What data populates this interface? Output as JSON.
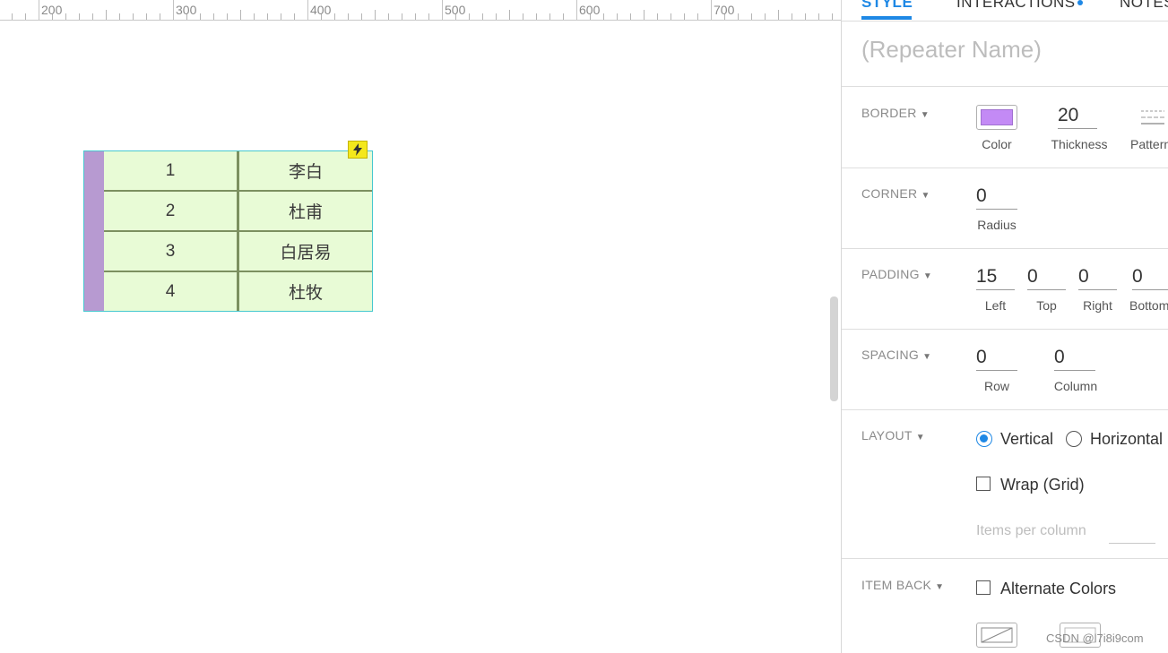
{
  "ruler": {
    "labels": [
      "200",
      "300",
      "400",
      "500",
      "600",
      "700"
    ]
  },
  "repeater": {
    "rows": [
      {
        "num": "1",
        "name": "李白"
      },
      {
        "num": "2",
        "name": "杜甫"
      },
      {
        "num": "3",
        "name": "白居易"
      },
      {
        "num": "4",
        "name": "杜牧"
      }
    ],
    "cell_color": "#e8fbd6",
    "border_color": "#b79ad1"
  },
  "panel": {
    "tabs": {
      "style": "STYLE",
      "interactions": "INTERACTIONS",
      "notes": "NOTES"
    },
    "repeater_name_placeholder": "(Repeater Name)",
    "border": {
      "label": "BORDER",
      "color_label": "Color",
      "color": "#c38af5",
      "thickness": "20",
      "thickness_label": "Thickness",
      "pattern_label": "Pattern"
    },
    "corner": {
      "label": "CORNER",
      "radius": "0",
      "radius_label": "Radius"
    },
    "padding": {
      "label": "PADDING",
      "left": "15",
      "left_label": "Left",
      "top": "0",
      "top_label": "Top",
      "right": "0",
      "right_label": "Right",
      "bottom": "0",
      "bottom_label": "Bottom"
    },
    "spacing": {
      "label": "SPACING",
      "row": "0",
      "row_label": "Row",
      "column": "0",
      "column_label": "Column"
    },
    "layout": {
      "label": "LAYOUT",
      "vertical": "Vertical",
      "horizontal": "Horizontal",
      "selected": "Vertical",
      "wrap": "Wrap (Grid)",
      "items_per_column": "Items per column"
    },
    "item_back": {
      "label": "ITEM BACK",
      "alternate": "Alternate Colors"
    }
  },
  "watermark": "CSDN @l7i8i9com"
}
